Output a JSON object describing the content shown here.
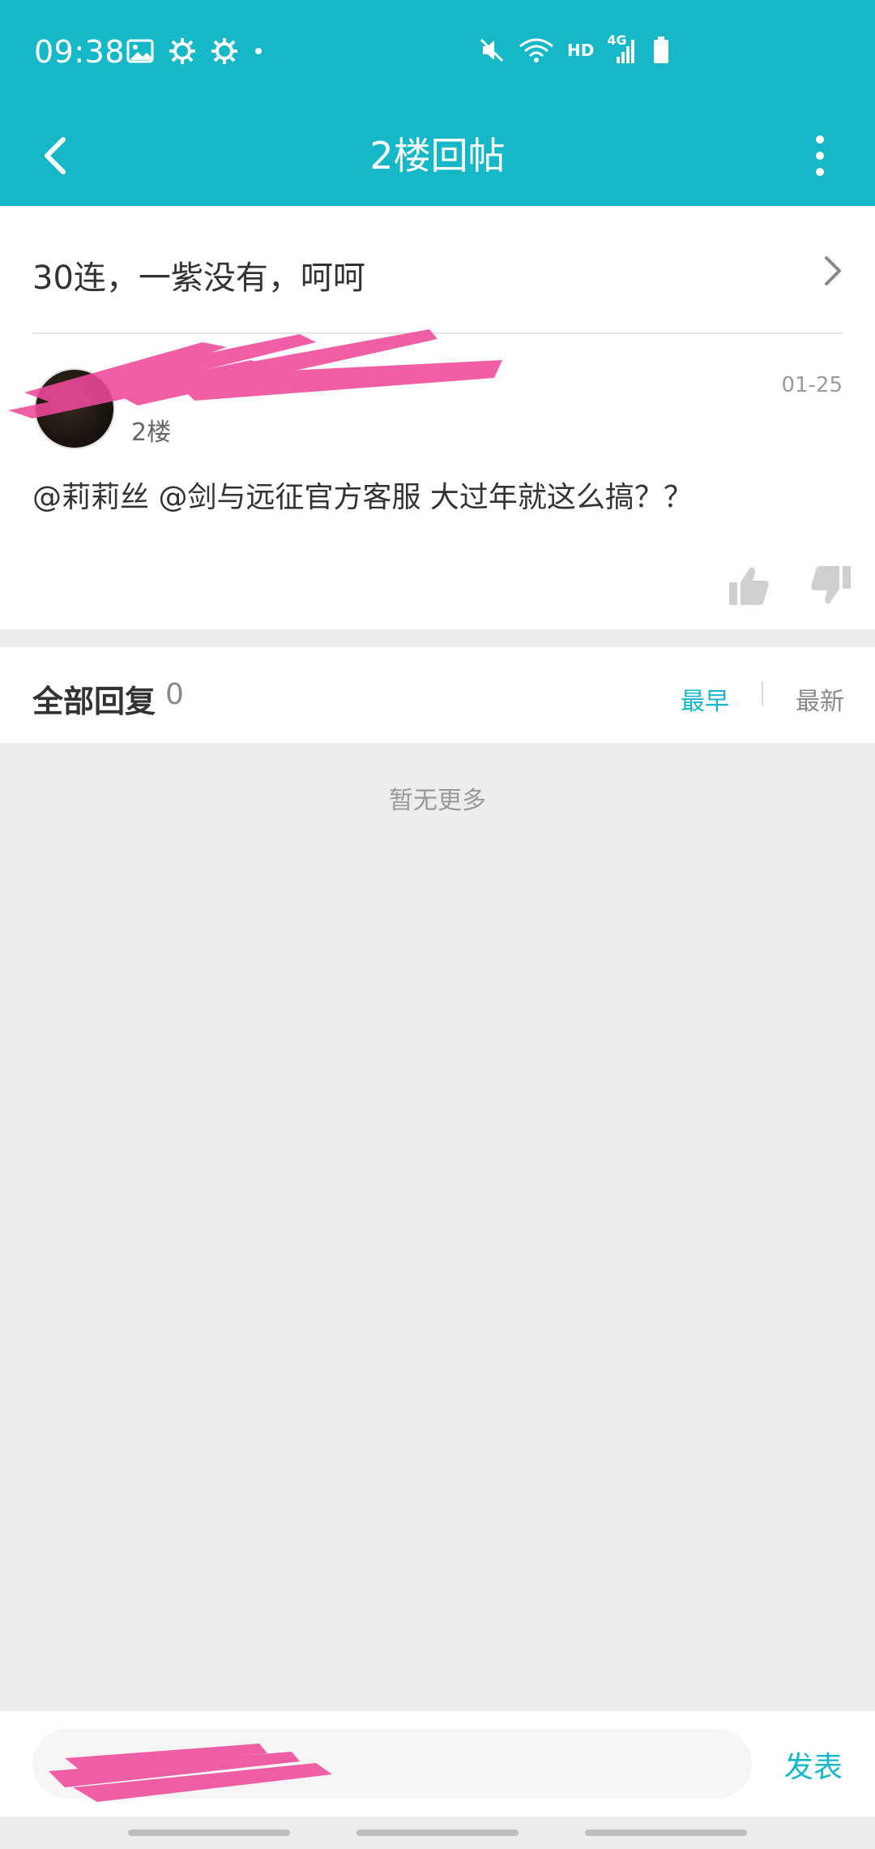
{
  "status_bar": {
    "time": "09:38",
    "icons": [
      "image-icon",
      "gear-icon",
      "gear-icon",
      "dot-icon",
      "mute-icon",
      "wifi-icon",
      "hd-label",
      "signal-4g-icon",
      "battery-icon"
    ],
    "hd": "HD",
    "network": "4G"
  },
  "header": {
    "title": "2楼回帖",
    "back_icon": "back-arrow-icon",
    "more_icon": "more-vert-icon",
    "color": "#16b8c8"
  },
  "post": {
    "thread_title": "30连，一紫没有，呵呵",
    "floor": "2楼",
    "date": "01-25",
    "content": "@莉莉丝 @剑与远征官方客服  大过年就这么搞？？"
  },
  "replies": {
    "title": "全部回复",
    "count": "0",
    "sort_earliest": "最早",
    "sort_latest": "最新",
    "empty_text": "暂无更多"
  },
  "compose": {
    "submit": "发表"
  },
  "colors": {
    "accent": "#16b8c8",
    "redaction": "#ee4a9a"
  }
}
